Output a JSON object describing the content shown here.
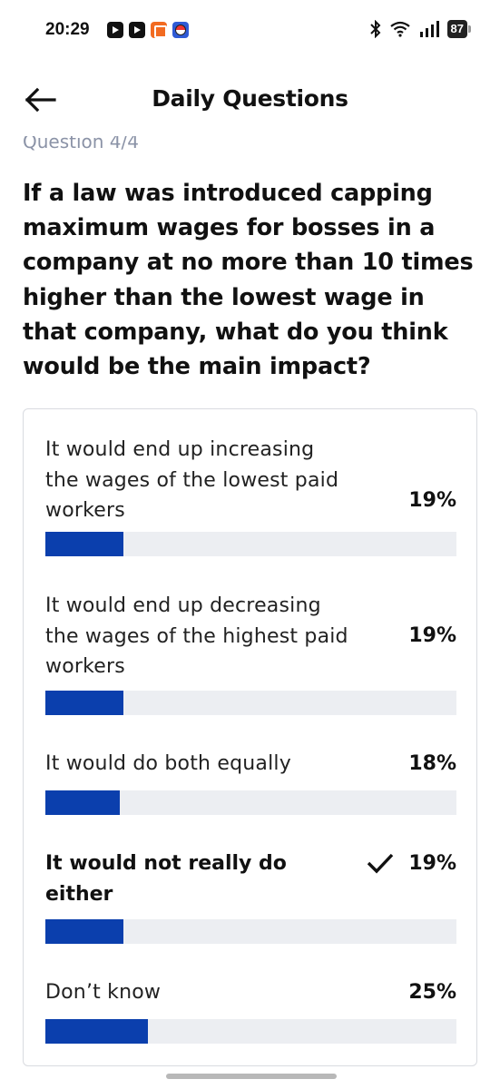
{
  "status_bar": {
    "time": "20:29",
    "battery": "87",
    "notification_icons": [
      "youtube-icon",
      "youtube-icon",
      "orange-app-icon",
      "pokeball-app-icon"
    ],
    "system_icons": [
      "bluetooth-icon",
      "wifi-icon",
      "signal-icon",
      "battery-icon"
    ]
  },
  "header": {
    "title": "Daily Questions",
    "back_icon": "arrow-left-icon"
  },
  "question": {
    "counter": "Question 4/4",
    "text": "If a law was introduced capping maximum wages for bosses in a company at no more than 10 times higher than the lowest wage in that company, what do you think would be the main impact?"
  },
  "options": [
    {
      "label": "It would end up increasing the wages of the lowest paid workers",
      "percent_label": "19%",
      "percent": 19,
      "selected": false
    },
    {
      "label": "It would end up decreasing the wages of the highest paid workers",
      "percent_label": "19%",
      "percent": 19,
      "selected": false
    },
    {
      "label": "It would do both equally",
      "percent_label": "18%",
      "percent": 18,
      "selected": false
    },
    {
      "label": "It would not really do either",
      "percent_label": "19%",
      "percent": 19,
      "selected": true
    },
    {
      "label": "Don’t know",
      "percent_label": "25%",
      "percent": 25,
      "selected": false
    }
  ],
  "colors": {
    "bar_fill": "#0b3fad",
    "bar_track": "#eceef2",
    "counter_text": "#8b93a7"
  }
}
